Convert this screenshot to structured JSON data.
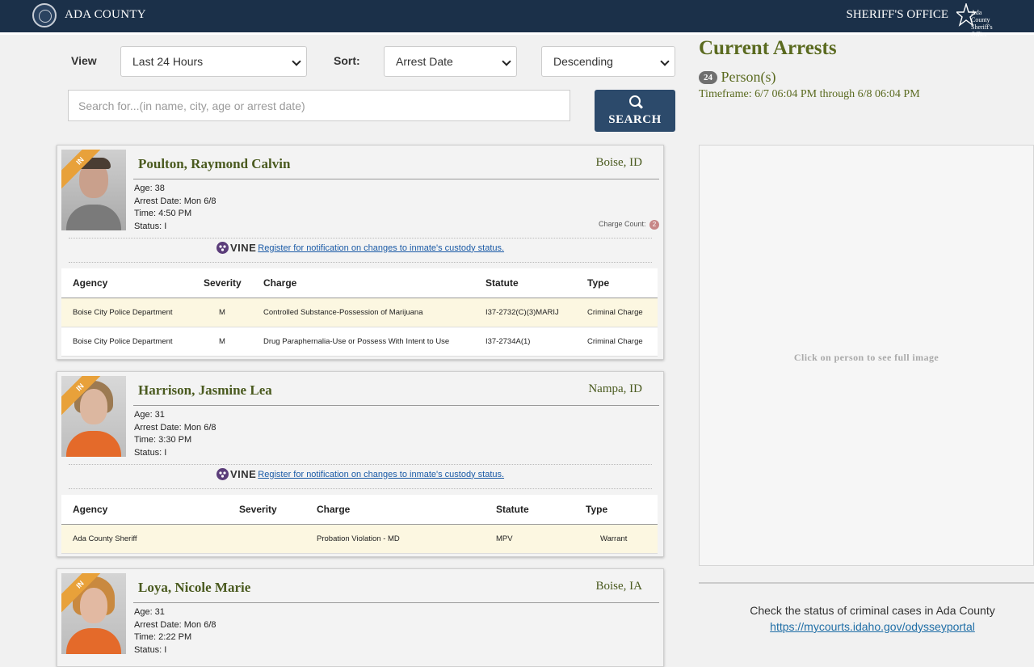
{
  "header": {
    "brand": "ADA COUNTY",
    "office": "SHERIFF'S OFFICE",
    "logo_text_line1": "Ada County",
    "logo_text_line2": "Sheriff's Office"
  },
  "filters": {
    "view_label": "View",
    "view_value": "Last 24 Hours",
    "sort_label": "Sort:",
    "sort_value": "Arrest Date",
    "order_value": "Descending",
    "search_placeholder": "Search for...(in name, city, age or arrest date)",
    "search_button": "SEARCH"
  },
  "summary": {
    "title": "Current Arrests",
    "count": "24",
    "count_suffix": "Person(s)",
    "timeframe": "Timeframe: 6/7 06:04 PM through 6/8 06:04 PM"
  },
  "viewer": {
    "hint": "Click on person to see full image"
  },
  "courts": {
    "text": "Check the status of criminal cases in Ada County",
    "link": "https://mycourts.idaho.gov/odysseyportal"
  },
  "vine": {
    "brand": "VINE",
    "link_text": "Register for notification on changes to inmate's custody status."
  },
  "table_headers": {
    "agency": "Agency",
    "severity": "Severity",
    "charge": "Charge",
    "statute": "Statute",
    "type": "Type"
  },
  "inmates": [
    {
      "ribbon": "IN",
      "name": "Poulton, Raymond Calvin",
      "city": "Boise, ID",
      "age": "Age: 38",
      "arrest_date": "Arrest Date: Mon 6/8",
      "time": "Time: 4:50 PM",
      "status": "Status: I",
      "charge_count_label": "Charge Count:",
      "charge_count": "2",
      "charges": [
        {
          "agency": "Boise City Police Department",
          "severity": "M",
          "charge": "Controlled Substance-Possession of Marijuana",
          "statute": "I37-2732(C)(3)MARIJ",
          "type": "Criminal Charge"
        },
        {
          "agency": "Boise City Police Department",
          "severity": "M",
          "charge": "Drug Paraphernalia-Use or Possess With Intent to Use",
          "statute": "I37-2734A(1)",
          "type": "Criminal Charge"
        }
      ]
    },
    {
      "ribbon": "IN",
      "name": "Harrison, Jasmine Lea",
      "city": "Nampa, ID",
      "age": "Age: 31",
      "arrest_date": "Arrest Date: Mon 6/8",
      "time": "Time: 3:30 PM",
      "status": "Status: I",
      "charges": [
        {
          "agency": "Ada County Sheriff",
          "severity": "",
          "charge": "Probation Violation - MD",
          "statute": "MPV",
          "type": "Warrant"
        }
      ]
    },
    {
      "ribbon": "IN",
      "name": "Loya, Nicole Marie",
      "city": "Boise, IA",
      "age": "Age: 31",
      "arrest_date": "Arrest Date: Mon 6/8",
      "time": "Time: 2:22 PM",
      "status": "Status: I"
    }
  ],
  "colors": {
    "header_bg": "#1b3049",
    "accent_olive": "#5a6a1f",
    "ribbon": "#e8a13a",
    "search_button": "#2c4a6b",
    "row_highlight": "#fcf7e1"
  }
}
